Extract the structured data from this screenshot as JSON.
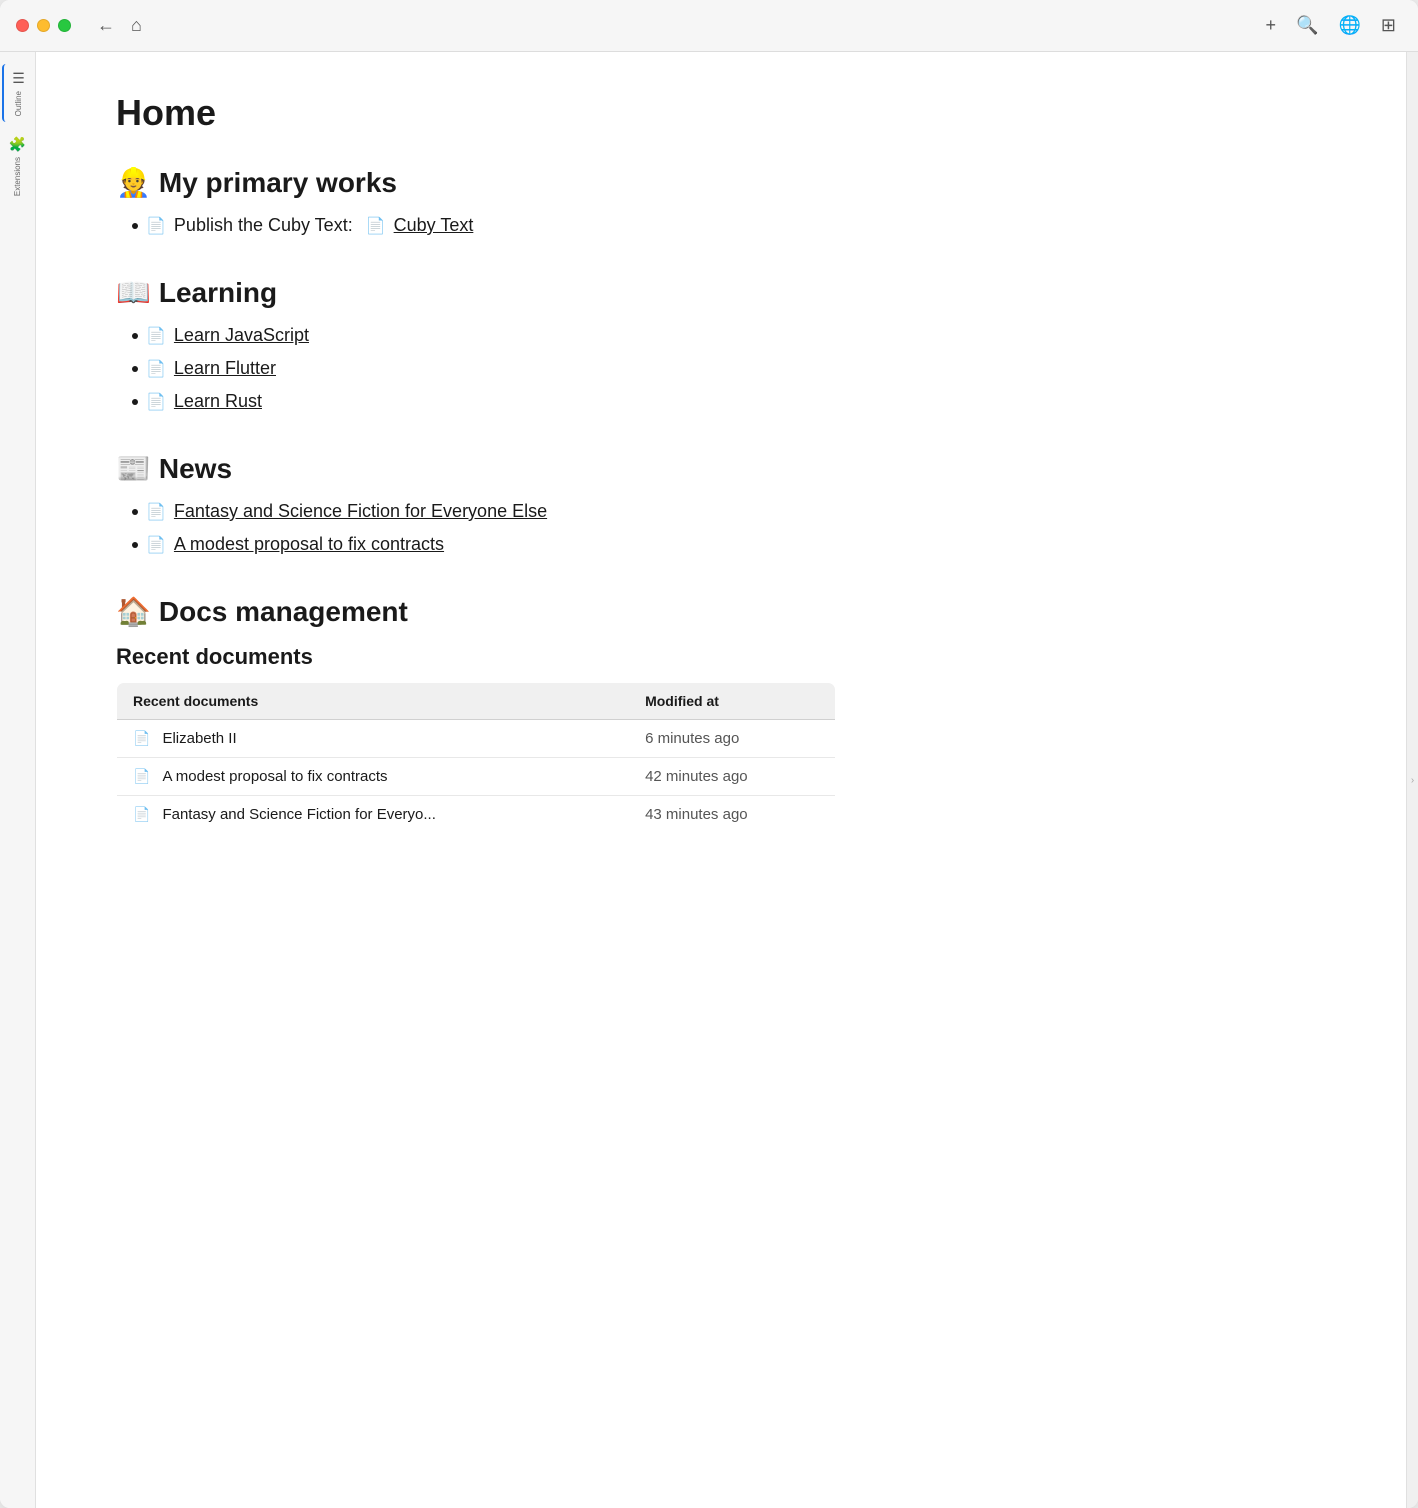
{
  "window": {
    "title": "Home"
  },
  "titlebar": {
    "back_label": "←",
    "home_label": "⌂",
    "add_label": "+",
    "search_label": "🔍",
    "globe_label": "🌐",
    "layout_label": "⊞"
  },
  "sidebar": {
    "items": [
      {
        "id": "outline",
        "label": "Outline",
        "icon": "☰",
        "active": true
      },
      {
        "id": "extensions",
        "label": "Extensions",
        "icon": "🧩",
        "active": false
      }
    ]
  },
  "page": {
    "title": "Home",
    "sections": [
      {
        "id": "primary-works",
        "emoji": "👷",
        "heading": "My primary works",
        "items": [
          {
            "text": "Publish the Cuby Text:",
            "link": "Cuby Text",
            "has_link": true,
            "is_plain_text": true
          }
        ]
      },
      {
        "id": "learning",
        "emoji": "📖",
        "heading": "Learning",
        "items": [
          {
            "link": "Learn JavaScript",
            "has_link": true
          },
          {
            "link": "Learn Flutter",
            "has_link": true
          },
          {
            "link": "Learn Rust",
            "has_link": true
          }
        ]
      },
      {
        "id": "news",
        "emoji": "📰",
        "heading": "News",
        "items": [
          {
            "link": "Fantasy and Science Fiction for Everyone Else",
            "has_link": true
          },
          {
            "link": "A modest proposal to fix contracts",
            "has_link": true
          }
        ]
      },
      {
        "id": "docs-management",
        "emoji": "🏠",
        "heading": "Docs management",
        "has_table": true,
        "table_heading": "Recent documents",
        "table": {
          "columns": [
            "Recent documents",
            "Modified at"
          ],
          "rows": [
            {
              "name": "Elizabeth II",
              "modified": "6 minutes ago"
            },
            {
              "name": "A modest proposal to fix contracts",
              "modified": "42 minutes ago"
            },
            {
              "name": "Fantasy and Science Fiction for Everyo...",
              "modified": "43 minutes ago"
            }
          ]
        }
      }
    ]
  }
}
